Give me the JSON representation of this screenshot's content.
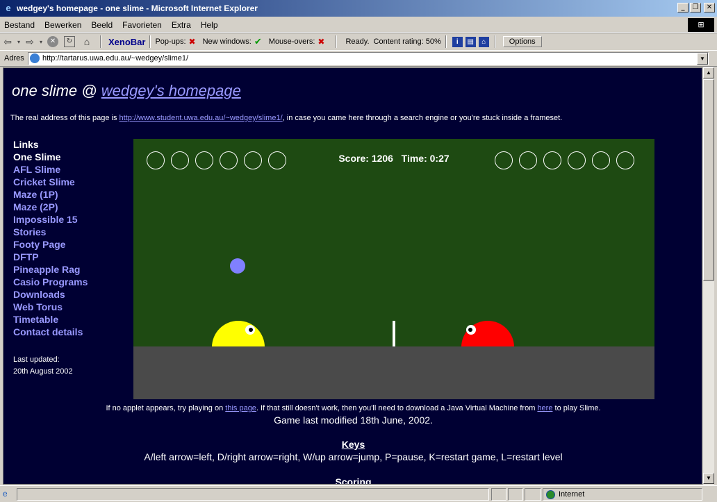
{
  "window": {
    "title": "wedgey's homepage - one slime - Microsoft Internet Explorer",
    "minimize": "_",
    "restore": "❐",
    "close": "✕"
  },
  "menu": [
    "Bestand",
    "Bewerken",
    "Beeld",
    "Favorieten",
    "Extra",
    "Help"
  ],
  "toolbar": {
    "brand": "XenoBar",
    "popups_label": "Pop-ups:",
    "new_windows_label": "New windows:",
    "mouseovers_label": "Mouse-overs:",
    "status": "Ready.",
    "content_rating": "Content rating: 50%",
    "options_label": "Options"
  },
  "address": {
    "label": "Adres",
    "url": "http://tartarus.uwa.edu.au/~wedgey/slime1/"
  },
  "page": {
    "title_prefix": "one slime @ ",
    "title_link": "wedgey's homepage",
    "real_address_prefix": "The real address of this page is ",
    "real_address_link": "http://www.student.uwa.edu.au/~wedgey/slime1/",
    "real_address_suffix": ", in case you came here through a search engine or you're stuck inside a frameset.",
    "links_heading": "Links",
    "links": [
      {
        "label": "One Slime",
        "current": true
      },
      {
        "label": "AFL Slime",
        "current": false
      },
      {
        "label": "Cricket Slime",
        "current": false
      },
      {
        "label": "Maze (1P)",
        "current": false
      },
      {
        "label": "Maze (2P)",
        "current": false
      },
      {
        "label": "Impossible 15",
        "current": false
      },
      {
        "label": "Stories",
        "current": false
      },
      {
        "label": "Footy Page",
        "current": false
      },
      {
        "label": "DFTP",
        "current": false
      },
      {
        "label": "Pineapple Rag",
        "current": false
      },
      {
        "label": "Casio Programs",
        "current": false
      },
      {
        "label": "Downloads",
        "current": false
      },
      {
        "label": "Web Torus",
        "current": false
      },
      {
        "label": "Timetable",
        "current": false
      },
      {
        "label": "Contact details",
        "current": false
      }
    ],
    "last_updated_label": "Last updated:",
    "last_updated_date": "20th August 2002",
    "note_prefix": "If no applet appears, try playing on ",
    "note_link1": "this page",
    "note_middle": ". If that still doesn't work, then you'll need to download a Java Virtual Machine from ",
    "note_link2": "here",
    "note_suffix": " to play Slime.",
    "modified": "Game last modified 18th June, 2002.",
    "keys_heading": "Keys",
    "keys_text": "A/left arrow=left, D/right arrow=right, W/up arrow=jump, P=pause, K=restart game, L=restart level",
    "scoring_heading": "Scoring"
  },
  "game": {
    "score_label": "Score:",
    "score": "1206",
    "time_label": "Time:",
    "time": "0:27",
    "left_rings": 6,
    "right_rings": 6,
    "colors": {
      "court": "#1e4a12",
      "ground": "#4a4a4a",
      "ball": "#8080ff",
      "player": "#ffff00",
      "opponent": "#ff0000"
    }
  },
  "statusbar": {
    "zone": "Internet"
  }
}
